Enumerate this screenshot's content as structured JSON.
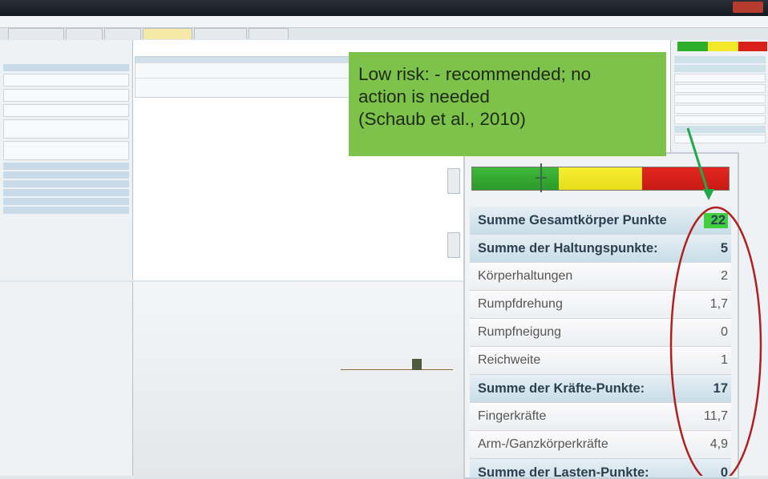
{
  "window": {
    "title": ""
  },
  "callout": {
    "line1": "Low risk: - recommended; no",
    "line2": "action is needed",
    "line3": "(Schaub et al., 2010)"
  },
  "score_panel": {
    "rows": [
      {
        "label": "Summe Gesamtkörper Punkte",
        "value": "22",
        "style": "head-highlight"
      },
      {
        "label": "Summe der Haltungspunkte:",
        "value": "5",
        "style": "head"
      },
      {
        "label": "Körperhaltungen",
        "value": "2",
        "style": "item"
      },
      {
        "label": "Rumpfdrehung",
        "value": "1,7",
        "style": "item"
      },
      {
        "label": "Rumpfneigung",
        "value": "0",
        "style": "item"
      },
      {
        "label": "Reichweite",
        "value": "1",
        "style": "item"
      },
      {
        "label": "Summe der Kräfte-Punkte:",
        "value": "17",
        "style": "head"
      },
      {
        "label": "Fingerkräfte",
        "value": "11,7",
        "style": "item"
      },
      {
        "label": "Arm-/Ganzkörperkräfte",
        "value": "4,9",
        "style": "item"
      },
      {
        "label": "Summe der Lasten-Punkte:",
        "value": "0",
        "style": "head"
      }
    ],
    "risk_scale": {
      "green": "#2fae2c",
      "yellow": "#f2e828",
      "red": "#d9211b"
    },
    "marker_fraction": 0.29
  },
  "colors": {
    "callout_bg": "#7dc24a",
    "arrow": "#22a84a",
    "ellipse": "#b0201e",
    "highlight": "#3fcf3f"
  }
}
